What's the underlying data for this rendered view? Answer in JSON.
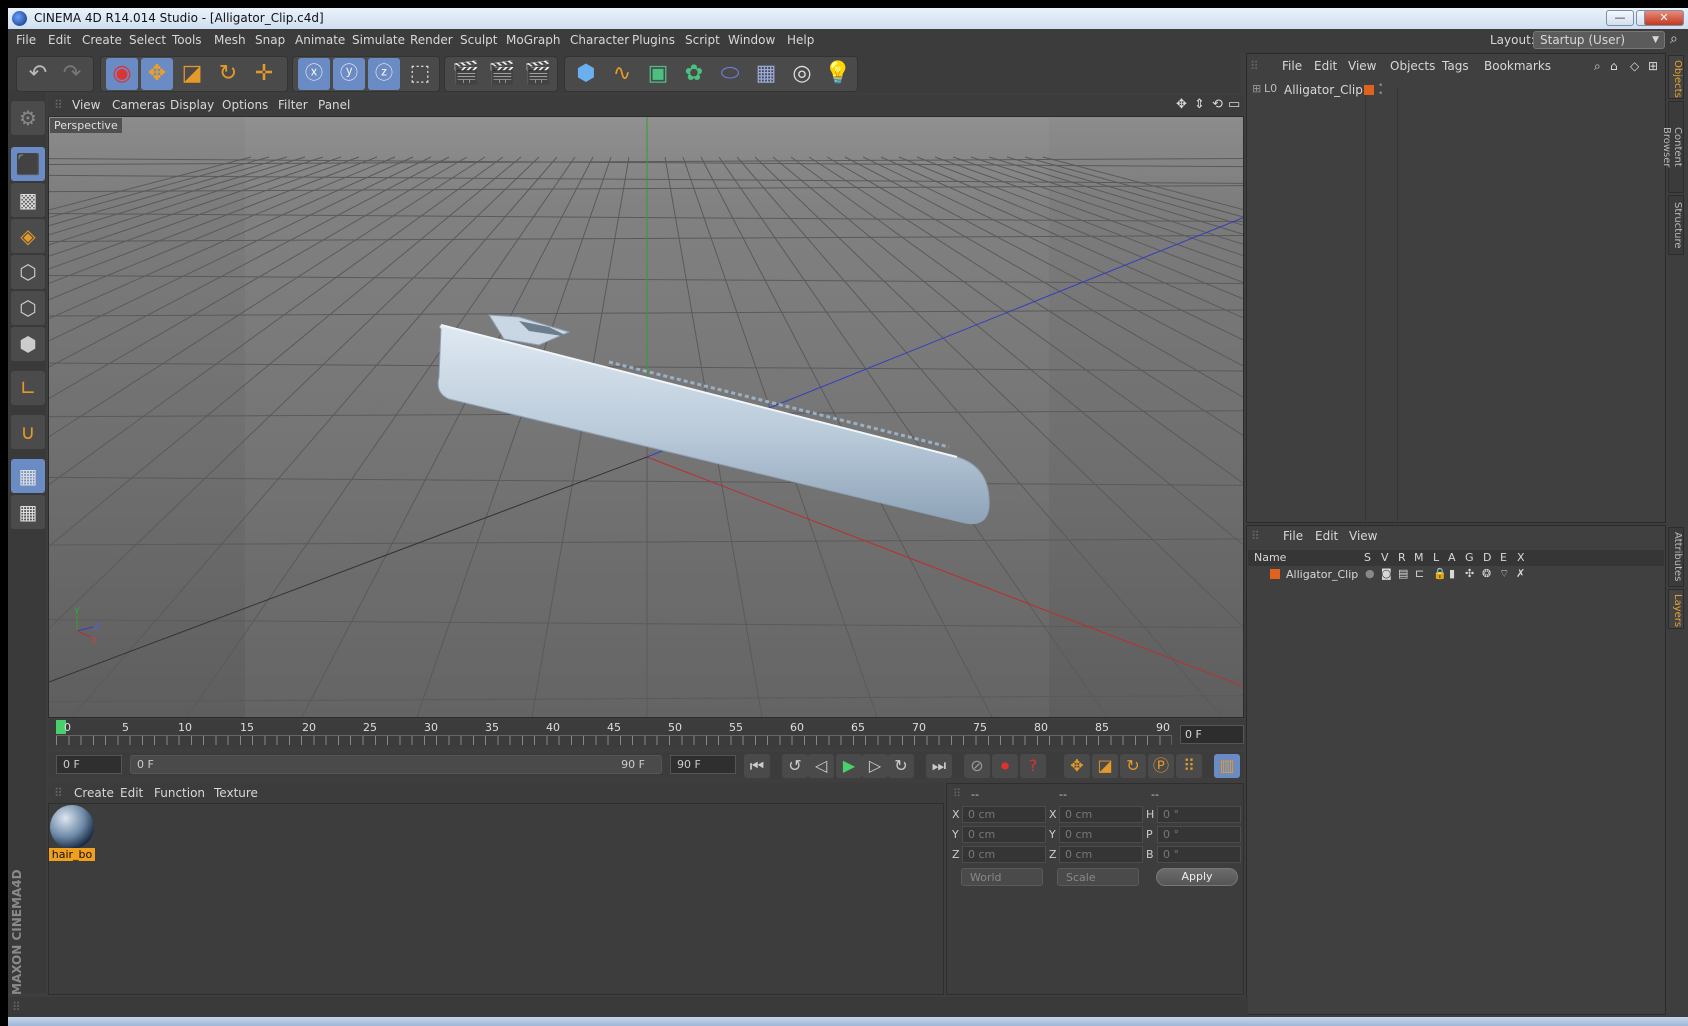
{
  "window": {
    "title": "CINEMA 4D R14.014 Studio - [Alligator_Clip.c4d]",
    "min": "—",
    "max": "❐",
    "close": "✕"
  },
  "menubar": {
    "items": [
      "File",
      "Edit",
      "Create",
      "Select",
      "Tools",
      "Mesh",
      "Snap",
      "Animate",
      "Simulate",
      "Render",
      "Sculpt",
      "MoGraph",
      "Character",
      "Plugins",
      "Script",
      "Window",
      "Help"
    ],
    "layout_label": "Layout:",
    "layout_value": "Startup (User)"
  },
  "viewport": {
    "menu": [
      "View",
      "Cameras",
      "Display",
      "Options",
      "Filter",
      "Panel"
    ],
    "label": "Perspective",
    "axis_labels": {
      "y": "Y",
      "z": "Z",
      "x": "X"
    }
  },
  "timeline": {
    "ticks": [
      "0",
      "5",
      "10",
      "15",
      "20",
      "25",
      "30",
      "35",
      "40",
      "45",
      "50",
      "55",
      "60",
      "65",
      "70",
      "75",
      "80",
      "85",
      "90"
    ],
    "current_frame": "0 F",
    "start_field": "0 F",
    "range_start": "0 F",
    "range_end": "90 F",
    "end_field": "90 F"
  },
  "material_manager": {
    "menu": [
      "Create",
      "Edit",
      "Function",
      "Texture"
    ],
    "materials": [
      {
        "name": "hair_bo"
      }
    ]
  },
  "coordinates": {
    "header": [
      "--",
      "--",
      "--"
    ],
    "rows": [
      {
        "l1": "X",
        "v1": "0 cm",
        "l2": "X",
        "v2": "0 cm",
        "l3": "H",
        "v3": "0 °"
      },
      {
        "l1": "Y",
        "v1": "0 cm",
        "l2": "Y",
        "v2": "0 cm",
        "l3": "P",
        "v3": "0 °"
      },
      {
        "l1": "Z",
        "v1": "0 cm",
        "l2": "Z",
        "v2": "0 cm",
        "l3": "B",
        "v3": "0 °"
      }
    ],
    "mode": "World",
    "scale": "Scale",
    "apply": "Apply"
  },
  "object_manager": {
    "menu": [
      "File",
      "Edit",
      "View",
      "Objects",
      "Tags",
      "Bookmarks"
    ],
    "objects": [
      {
        "name": "Alligator_Clip"
      }
    ],
    "tabs": [
      "Objects",
      "Content Browser",
      "Structure"
    ]
  },
  "layer_manager": {
    "menu": [
      "File",
      "Edit",
      "View"
    ],
    "columns": [
      "Name",
      "S",
      "V",
      "R",
      "M",
      "L",
      "A",
      "G",
      "D",
      "E",
      "X"
    ],
    "layers": [
      {
        "name": "Alligator_Clip"
      }
    ],
    "tabs": [
      "Attributes",
      "Layers"
    ]
  },
  "branding": "MAXON CINEMA4D",
  "colors": {
    "accent": "#f0a020",
    "active": "#6b8bc4",
    "x_axis": "#c03030",
    "y_axis": "#30a030",
    "z_axis": "#3040c0"
  }
}
